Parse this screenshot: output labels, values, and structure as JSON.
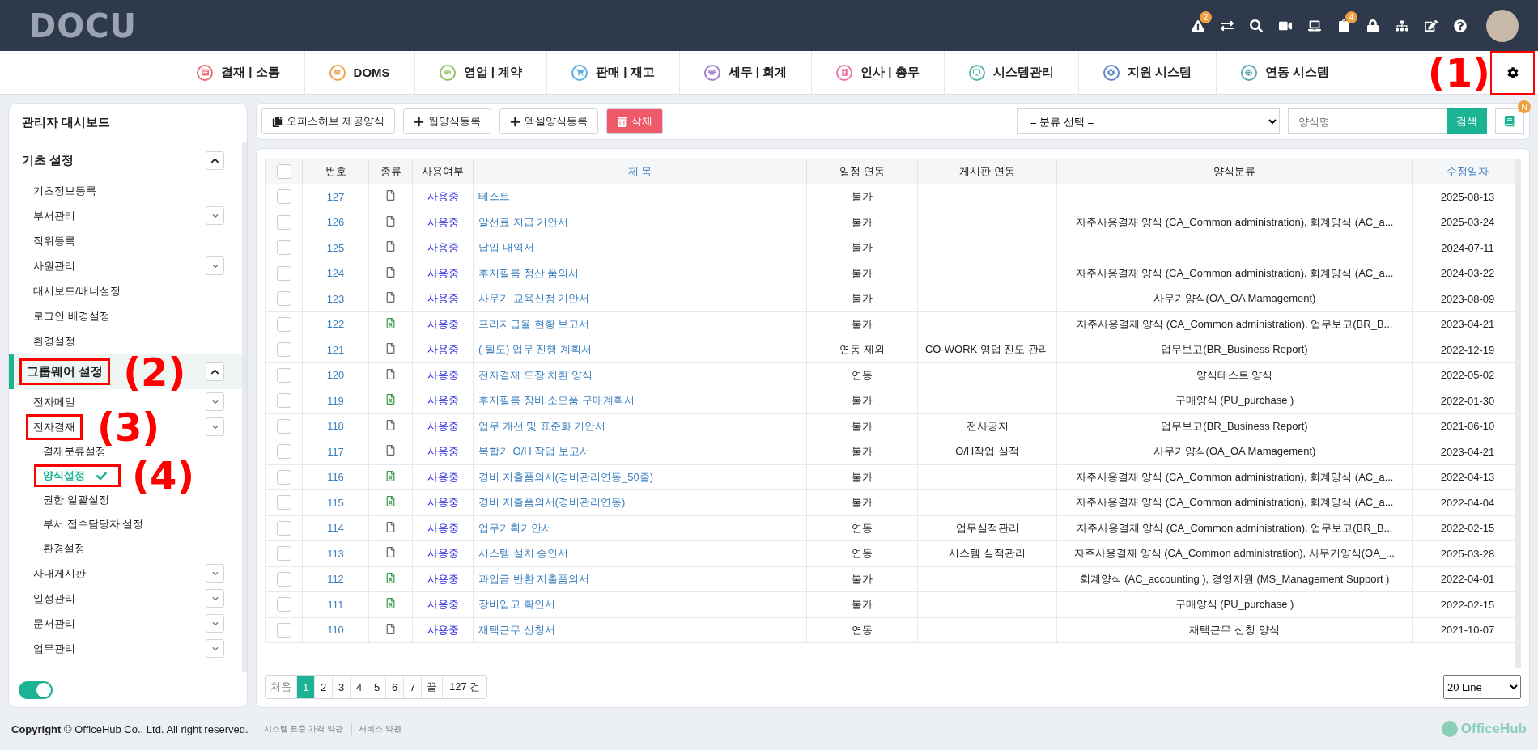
{
  "logo": {
    "text": "DOCU"
  },
  "top_icons": [
    {
      "kind": "warning",
      "badge": "2"
    },
    {
      "kind": "exchange"
    },
    {
      "kind": "search"
    },
    {
      "kind": "video"
    },
    {
      "kind": "laptop"
    },
    {
      "kind": "clipboard",
      "badge": "4"
    },
    {
      "kind": "lock"
    },
    {
      "kind": "sitemap"
    },
    {
      "kind": "edit"
    },
    {
      "kind": "help"
    }
  ],
  "nav": [
    {
      "label": "결재 | 소통",
      "color": "#e8707a"
    },
    {
      "label": "DOMS",
      "color": "#f0a050"
    },
    {
      "label": "영업 | 계약",
      "color": "#8cc56a"
    },
    {
      "label": "판매 | 재고",
      "color": "#5aaee0"
    },
    {
      "label": "세무 | 회계",
      "color": "#a07cc8"
    },
    {
      "label": "인사 | 총무",
      "color": "#e87aa8"
    },
    {
      "label": "시스템관리",
      "color": "#4fb8a8"
    },
    {
      "label": "지원 시스템",
      "color": "#5a86c8"
    },
    {
      "label": "연동 시스템",
      "color": "#5aa8b0"
    }
  ],
  "settings": {
    "annotation": "(1)"
  },
  "sidebar": {
    "title": "관리자 대시보드",
    "sections": [
      {
        "label": "기초 설정",
        "expanded": true,
        "selected": false,
        "items": [
          {
            "label": "기초정보등록",
            "kind": "link"
          },
          {
            "label": "부서관리",
            "kind": "group"
          },
          {
            "label": "직위등록",
            "kind": "link"
          },
          {
            "label": "사원관리",
            "kind": "group"
          },
          {
            "label": "대시보드/배너설정",
            "kind": "link"
          },
          {
            "label": "로그인 배경설정",
            "kind": "link"
          },
          {
            "label": "환경설정",
            "kind": "link"
          }
        ]
      },
      {
        "label": "그룹웨어 설정",
        "expanded": true,
        "selected": true,
        "annotation": "(2)",
        "items": [
          {
            "label": "전자메일",
            "kind": "group"
          },
          {
            "label": "전자결재",
            "kind": "group",
            "annotation": "(3)",
            "children": [
              {
                "label": "결재분류설정",
                "selected": false
              },
              {
                "label": "양식설정",
                "selected": true,
                "annotation": "(4)"
              },
              {
                "label": "권한 일괄설정",
                "selected": false
              },
              {
                "label": "부서 접수담당자 설정",
                "selected": false
              },
              {
                "label": "환경설정",
                "selected": false
              }
            ]
          },
          {
            "label": "사내게시판",
            "kind": "group"
          },
          {
            "label": "일정관리",
            "kind": "group"
          },
          {
            "label": "문서관리",
            "kind": "group"
          },
          {
            "label": "업무관리",
            "kind": "group"
          }
        ]
      }
    ],
    "toggle": {
      "on": true
    }
  },
  "toolbar": {
    "buttons": [
      {
        "label": "오피스허브 제공양식",
        "kind": "provided"
      },
      {
        "label": "웹양식등록",
        "kind": "add"
      },
      {
        "label": "엑셀양식등록",
        "kind": "add"
      },
      {
        "label": "삭제",
        "kind": "delete"
      }
    ],
    "category_select": "= 분류 선택 =",
    "search": {
      "placeholder": "양식명"
    },
    "search_button": "검색",
    "book_badge": "N"
  },
  "table": {
    "select_all": {
      "checked": false
    },
    "columns": [
      {
        "label": "번호",
        "link": false
      },
      {
        "label": "종류",
        "link": false
      },
      {
        "label": "사용여부",
        "link": false
      },
      {
        "label": "제 목",
        "link": true
      },
      {
        "label": "일정 연동",
        "link": false
      },
      {
        "label": "게시판 연동",
        "link": false
      },
      {
        "label": "양식분류",
        "link": false
      },
      {
        "label": "수정일자",
        "link": true
      }
    ],
    "rows": [
      {
        "checked": false,
        "no": "127",
        "kind": "doc",
        "status": "사용중",
        "title": "테스트",
        "schedule": "불가",
        "board": "",
        "category": "",
        "date": "2025-08-13"
      },
      {
        "checked": false,
        "no": "126",
        "kind": "doc",
        "status": "사용중",
        "title": "알선료 지급 기안서",
        "schedule": "불가",
        "board": "",
        "category": "자주사용결재 양식 (CA_Common administration), 회계양식 (AC_a...",
        "date": "2025-03-24"
      },
      {
        "checked": false,
        "no": "125",
        "kind": "doc",
        "status": "사용중",
        "title": "납입 내역서",
        "schedule": "불가",
        "board": "",
        "category": "",
        "date": "2024-07-11"
      },
      {
        "checked": false,
        "no": "124",
        "kind": "doc",
        "status": "사용중",
        "title": "후지필름 정산 품의서",
        "schedule": "불가",
        "board": "",
        "category": "자주사용결재 양식 (CA_Common administration), 회계양식 (AC_a...",
        "date": "2024-03-22"
      },
      {
        "checked": false,
        "no": "123",
        "kind": "doc",
        "status": "사용중",
        "title": "사무기 교육신청 기안서",
        "schedule": "불가",
        "board": "",
        "category": "사무기양식(OA_OA Mamagement)",
        "date": "2023-08-09"
      },
      {
        "checked": false,
        "no": "122",
        "kind": "excel",
        "status": "사용중",
        "title": "프리지급율 현황 보고서",
        "schedule": "불가",
        "board": "",
        "category": "자주사용결재 양식 (CA_Common administration), 업무보고(BR_B...",
        "date": "2023-04-21"
      },
      {
        "checked": false,
        "no": "121",
        "kind": "doc",
        "status": "사용중",
        "title": "( 월도) 업무 진행 계획서",
        "schedule": "연동 제외",
        "board": "CO-WORK 영업 진도 관리",
        "category": "업무보고(BR_Business Report)",
        "date": "2022-12-19"
      },
      {
        "checked": false,
        "no": "120",
        "kind": "doc",
        "status": "사용중",
        "title": "전자결재 도장 치환 양식",
        "schedule": "연동",
        "board": "",
        "category": "양식테스트 양식",
        "date": "2022-05-02"
      },
      {
        "checked": false,
        "no": "119",
        "kind": "excel",
        "status": "사용중",
        "title": "후지필름 장비.소모품 구매계획서",
        "schedule": "불가",
        "board": "",
        "category": "구매양식 (PU_purchase )",
        "date": "2022-01-30"
      },
      {
        "checked": false,
        "no": "118",
        "kind": "doc",
        "status": "사용중",
        "title": "업무 개선 및 표준화 기안서",
        "schedule": "불가",
        "board": "전사공지",
        "category": "업무보고(BR_Business Report)",
        "date": "2021-06-10"
      },
      {
        "checked": false,
        "no": "117",
        "kind": "doc",
        "status": "사용중",
        "title": "복합기 O/H 작업 보고서",
        "schedule": "불가",
        "board": "O/H작업 실적",
        "category": "사무기양식(OA_OA Mamagement)",
        "date": "2023-04-21"
      },
      {
        "checked": false,
        "no": "116",
        "kind": "excel",
        "status": "사용중",
        "title": "경비 지출품의서(경비관리연동_50줄)",
        "schedule": "불가",
        "board": "",
        "category": "자주사용결재 양식 (CA_Common administration), 회계양식 (AC_a...",
        "date": "2022-04-13"
      },
      {
        "checked": false,
        "no": "115",
        "kind": "excel",
        "status": "사용중",
        "title": "경비 지출품의서(경비관리연동)",
        "schedule": "불가",
        "board": "",
        "category": "자주사용결재 양식 (CA_Common administration), 회계양식 (AC_a...",
        "date": "2022-04-04"
      },
      {
        "checked": false,
        "no": "114",
        "kind": "doc",
        "status": "사용중",
        "title": "업무기획기안서",
        "schedule": "연동",
        "board": "업무실적관리",
        "category": "자주사용결재 양식 (CA_Common administration), 업무보고(BR_B...",
        "date": "2022-02-15"
      },
      {
        "checked": false,
        "no": "113",
        "kind": "doc",
        "status": "사용중",
        "title": "시스템 설치 승인서",
        "schedule": "연동",
        "board": "시스템 실적관리",
        "category": "자주사용결재 양식 (CA_Common administration), 사무기양식(OA_...",
        "date": "2025-03-28"
      },
      {
        "checked": false,
        "no": "112",
        "kind": "excel",
        "status": "사용중",
        "title": "과입금 반환 지출품의서",
        "schedule": "불가",
        "board": "",
        "category": "회계양식 (AC_accounting ), 경영지원 (MS_Management Support )",
        "date": "2022-04-01"
      },
      {
        "checked": false,
        "no": "111",
        "kind": "excel",
        "status": "사용중",
        "title": "장비입고 확인서",
        "schedule": "불가",
        "board": "",
        "category": "구매양식 (PU_purchase )",
        "date": "2022-02-15"
      },
      {
        "checked": false,
        "no": "110",
        "kind": "doc",
        "status": "사용중",
        "title": "재택근무 신청서",
        "schedule": "연동",
        "board": "",
        "category": "재택근무 신청 양식",
        "date": "2021-10-07"
      }
    ]
  },
  "pagination": {
    "first": "처음",
    "pages": [
      {
        "label": "1",
        "selected": true
      },
      {
        "label": "2",
        "selected": false
      },
      {
        "label": "3",
        "selected": false
      },
      {
        "label": "4",
        "selected": false
      },
      {
        "label": "5",
        "selected": false
      },
      {
        "label": "6",
        "selected": false
      },
      {
        "label": "7",
        "selected": false
      }
    ],
    "last": "끝",
    "total": "127 건",
    "per_page": "20 Line"
  },
  "footer": {
    "copyright": "**Copyright** © OfficeHub Co., Ltd. All right reserved.",
    "links": [
      "시스템 표준 가격 약관",
      "서비스 약관"
    ],
    "brand": "OfficeHub"
  }
}
